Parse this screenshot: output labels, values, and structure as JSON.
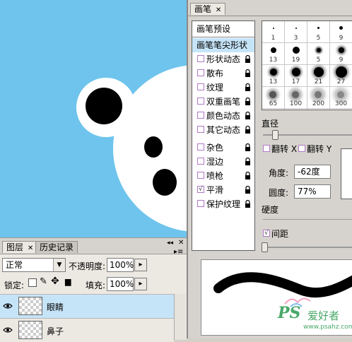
{
  "brush_panel": {
    "tab": "画笔",
    "options": [
      {
        "label": "画笔预设",
        "checkbox": false,
        "lock": false
      },
      {
        "label": "画笔笔尖形状",
        "checkbox": false,
        "lock": false,
        "selected": true
      },
      {
        "label": "形状动态",
        "checkbox": true,
        "checked": false,
        "lock": true
      },
      {
        "label": "散布",
        "checkbox": true,
        "checked": false,
        "lock": true
      },
      {
        "label": "纹理",
        "checkbox": true,
        "checked": false,
        "lock": true
      },
      {
        "label": "双重画笔",
        "checkbox": true,
        "checked": false,
        "lock": true
      },
      {
        "label": "颜色动态",
        "checkbox": true,
        "checked": false,
        "lock": true
      },
      {
        "label": "其它动态",
        "checkbox": true,
        "checked": false,
        "lock": true
      },
      {
        "label": "杂色",
        "checkbox": true,
        "checked": false,
        "lock": true
      },
      {
        "label": "湿边",
        "checkbox": true,
        "checked": false,
        "lock": true
      },
      {
        "label": "喷枪",
        "checkbox": true,
        "checked": false,
        "lock": true
      },
      {
        "label": "平滑",
        "checkbox": true,
        "checked": true,
        "lock": true
      },
      {
        "label": "保护纹理",
        "checkbox": true,
        "checked": false,
        "lock": true
      }
    ],
    "brush_sizes": [
      "1",
      "3",
      "5",
      "9",
      "13",
      "19",
      "5",
      "9",
      "13",
      "17",
      "21",
      "27",
      "35",
      "45",
      "65",
      "100",
      "200",
      "300",
      "39",
      "46",
      "59",
      "11"
    ],
    "diameter_label": "直径",
    "flip_x": "翻转 X",
    "flip_y": "翻转 Y",
    "angle_label": "角度:",
    "angle_value": "-62度",
    "roundness_label": "圆度:",
    "roundness_value": "77%",
    "hardness_label": "硬度",
    "spacing_label": "间距",
    "spacing_checked": true,
    "checkmark": "√"
  },
  "layers_panel": {
    "tabs": [
      "图层",
      "历史记录"
    ],
    "blend_mode": "正常",
    "opacity_label": "不透明度:",
    "opacity_value": "100%",
    "lock_label": "锁定:",
    "fill_label": "填充:",
    "fill_value": "100%",
    "layers": [
      {
        "name": "眼睛",
        "selected": true
      },
      {
        "name": "鼻子",
        "selected": false
      }
    ]
  },
  "watermark": {
    "logo": "PS",
    "text": "爱好者",
    "url": "www.psahz.com"
  },
  "colors": {
    "canvas_bg": "#6ec4ec",
    "panel_bg": "#d6d3ce",
    "selection": "#c6e4f8",
    "watermark": "#48a868"
  }
}
